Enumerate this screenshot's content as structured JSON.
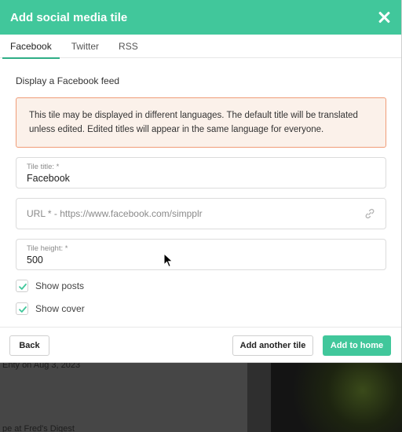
{
  "modal": {
    "title": "Add social media tile"
  },
  "tabs": [
    {
      "label": "Facebook",
      "active": true
    },
    {
      "label": "Twitter",
      "active": false
    },
    {
      "label": "RSS",
      "active": false
    }
  ],
  "section_label": "Display a Facebook feed",
  "alert": {
    "text": "This tile may be displayed in different languages. The default title will be translated unless edited. Edited titles will appear in the same language for everyone."
  },
  "fields": {
    "tile_title": {
      "label": "Tile title: *",
      "value": "Facebook"
    },
    "url": {
      "placeholder": "URL * - https://www.facebook.com/simpplr",
      "icon": "link-icon"
    },
    "tile_height": {
      "label": "Tile height: *",
      "value": "500"
    }
  },
  "checkboxes": [
    {
      "label": "Show posts",
      "checked": true
    },
    {
      "label": "Show cover",
      "checked": true
    }
  ],
  "footer": {
    "back_label": "Back",
    "add_another_label": "Add another tile",
    "add_home_label": "Add to home"
  },
  "background": {
    "text1": "Enty on Aug 3, 2023",
    "text2": "pe at Fred's Digest"
  },
  "colors": {
    "accent": "#41c79b",
    "alert_bg": "#fbf1ea",
    "alert_border": "#f09c78"
  }
}
